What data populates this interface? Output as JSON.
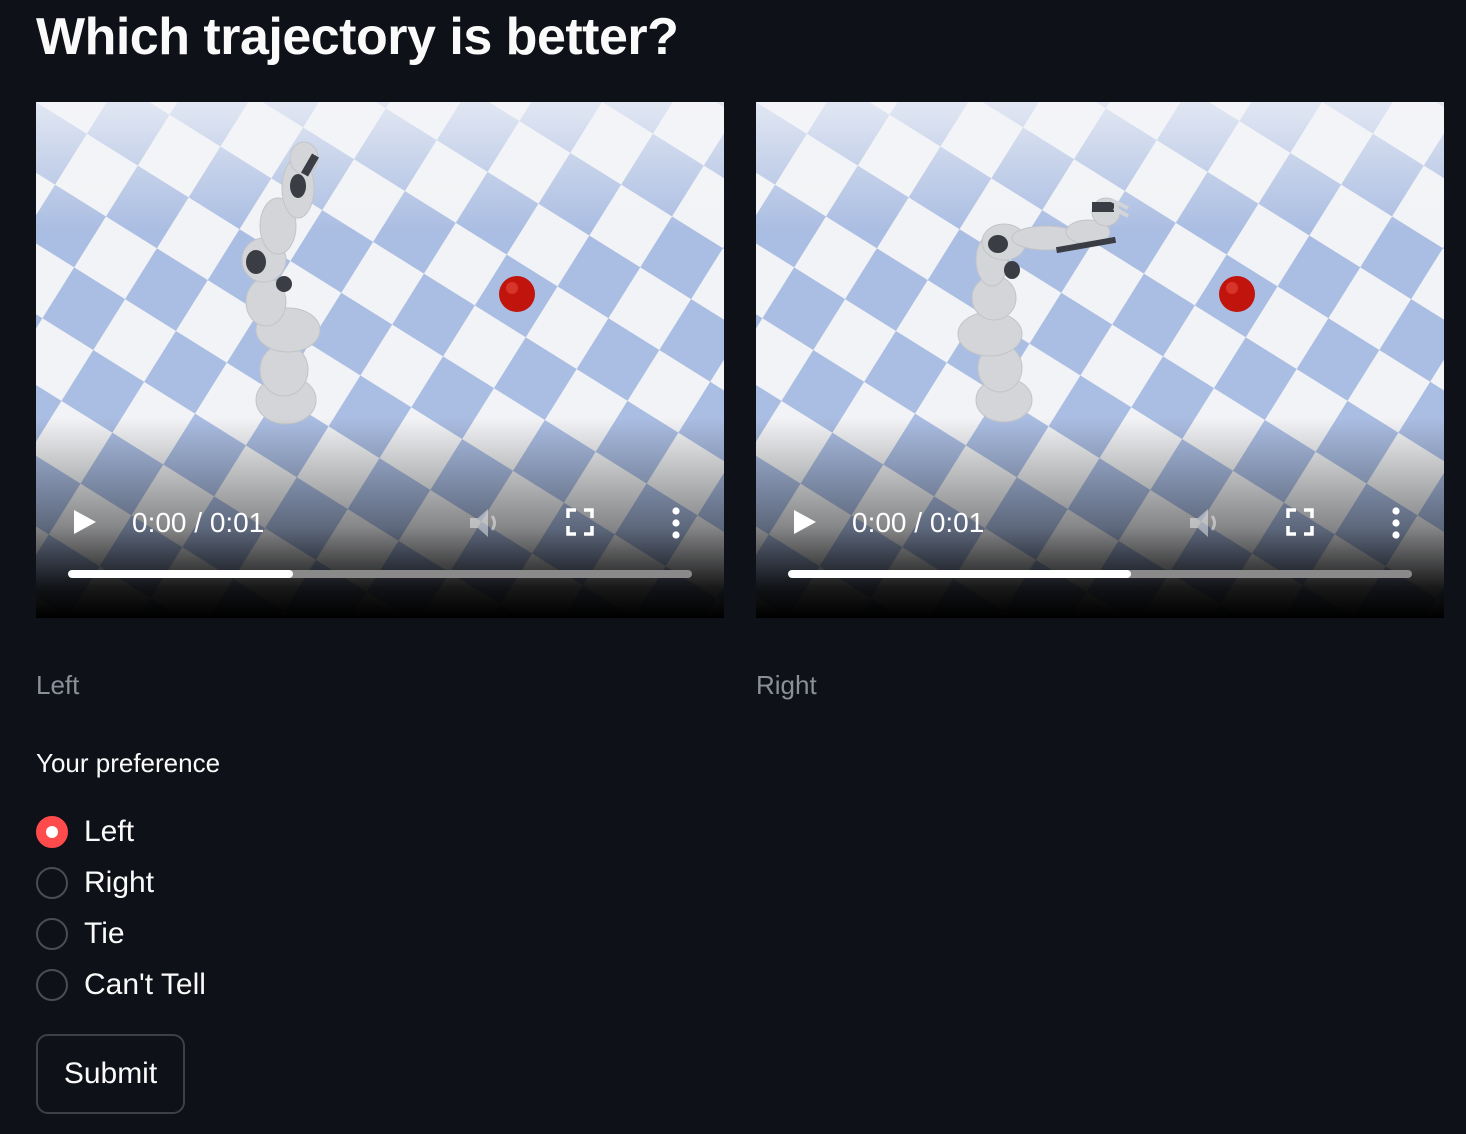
{
  "page": {
    "title": "Which trajectory is better?"
  },
  "videos": [
    {
      "id": "left",
      "time": "0:00 / 0:01",
      "progress": 0.36,
      "caption": "Left"
    },
    {
      "id": "right",
      "time": "0:00 / 0:01",
      "progress": 0.55,
      "caption": "Right"
    }
  ],
  "preference": {
    "label": "Your preference",
    "options": [
      "Left",
      "Right",
      "Tie",
      "Can't Tell"
    ],
    "selected": "Left"
  },
  "submit_label": "Submit",
  "colors": {
    "background": "#0e1117",
    "accent": "#ff4b4b",
    "checker_blue": "#aabde2",
    "checker_white": "#f2f3f6",
    "target_ball": "#c0140c"
  },
  "icons": [
    "play-icon",
    "volume-icon",
    "fullscreen-icon",
    "more-options-icon"
  ]
}
